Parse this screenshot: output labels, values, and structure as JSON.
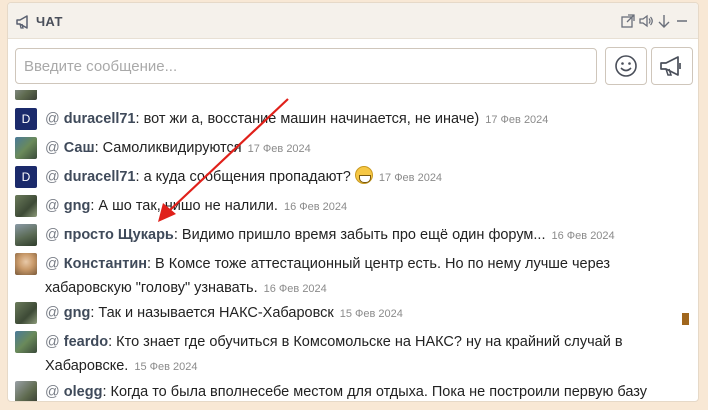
{
  "header": {
    "title": "ЧАТ"
  },
  "composer": {
    "placeholder": "Введите сообщение..."
  },
  "colors": {
    "accent": "#a0661d",
    "arrow": "#e0201a",
    "nick": "#3f4a5a"
  },
  "messages": [
    {
      "avatar_letter": "D",
      "at": "@",
      "nick": "duracell71",
      "text": ": вот жи а, восстание машин начинается, не иначе)",
      "date": "17 Фев 2024"
    },
    {
      "avatar_letter": "",
      "at": "@",
      "nick": "Саш",
      "text": ": Самоликвидируются",
      "date": "17 Фев 2024"
    },
    {
      "avatar_letter": "D",
      "at": "@",
      "nick": "duracell71",
      "text": ": а куда сообщения пропадают?",
      "date": "17 Фев 2024"
    },
    {
      "avatar_letter": "",
      "at": "@",
      "nick": "gng",
      "text": ": А шо так, нишо не налили.",
      "date": "16 Фев 2024"
    },
    {
      "avatar_letter": "",
      "at": "@",
      "nick": "просто Щукарь",
      "text": ": Видимо пришло время забыть про ещё один форум...",
      "date": "16 Фев 2024"
    },
    {
      "avatar_letter": "",
      "at": "@",
      "nick": "Константин",
      "text": ": В Комсе тоже аттестационный центр есть. Но по нему лучше через хабаровскую \"голову\" узнавать.",
      "date": "16 Фев 2024"
    },
    {
      "avatar_letter": "",
      "at": "@",
      "nick": "gng",
      "text": ": Так и называется НАКС-Хабаровск",
      "date": "15 Фев 2024"
    },
    {
      "avatar_letter": "",
      "at": "@",
      "nick": "feardo",
      "text": ": Кто знает где обучиться в Комсомольске на НАКС? ну на крайний случай в Хабаровске.",
      "date": "15 Фев 2024"
    },
    {
      "avatar_letter": "",
      "at": "@",
      "nick": "olegg",
      "text": ": Когда то была вполнесебе местом для отдыха. Пока не построили первую базу",
      "date": ""
    }
  ]
}
